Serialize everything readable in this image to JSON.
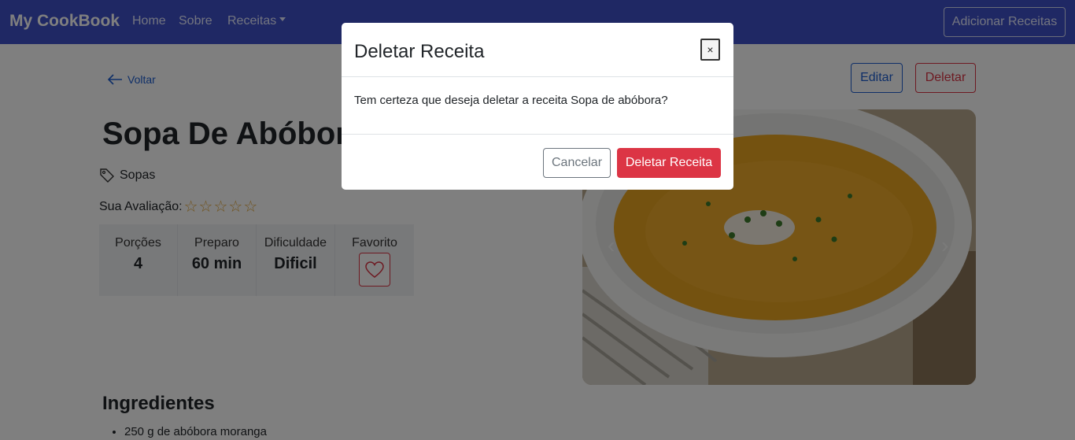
{
  "navbar": {
    "brand": "My CookBook",
    "links": [
      "Home",
      "Sobre",
      "Receitas"
    ],
    "add_button": "Adicionar Receitas"
  },
  "page": {
    "back_label": "Voltar",
    "edit_label": "Editar",
    "delete_label": "Deletar",
    "recipe_title": "Sopa De Abóbora",
    "category": "Sopas",
    "rating_label": "Sua Avaliação:",
    "rating_value": 0,
    "rating_max": 5,
    "info": [
      {
        "label": "Porções",
        "value": "4"
      },
      {
        "label": "Preparo",
        "value": "60 min"
      },
      {
        "label": "Dificuldade",
        "value": "Dificil"
      },
      {
        "label": "Favorito",
        "value": ""
      }
    ],
    "ingredients_title": "Ingredientes",
    "ingredients": [
      "250 g de abóbora moranga"
    ]
  },
  "modal": {
    "title": "Deletar Receita",
    "close_glyph": "×",
    "message": "Tem certeza que deseja deletar a receita Sopa de abóbora?",
    "cancel_label": "Cancelar",
    "confirm_label": "Deletar Receita"
  },
  "colors": {
    "navbar": "#3f51c8",
    "primary": "#1f5fd1",
    "danger": "#dc3545",
    "star": "#e0a53a"
  },
  "icons": {
    "back": "arrow-left-icon",
    "category": "tag-icon",
    "favorite": "heart-icon",
    "dropdown": "caret-down-icon"
  }
}
